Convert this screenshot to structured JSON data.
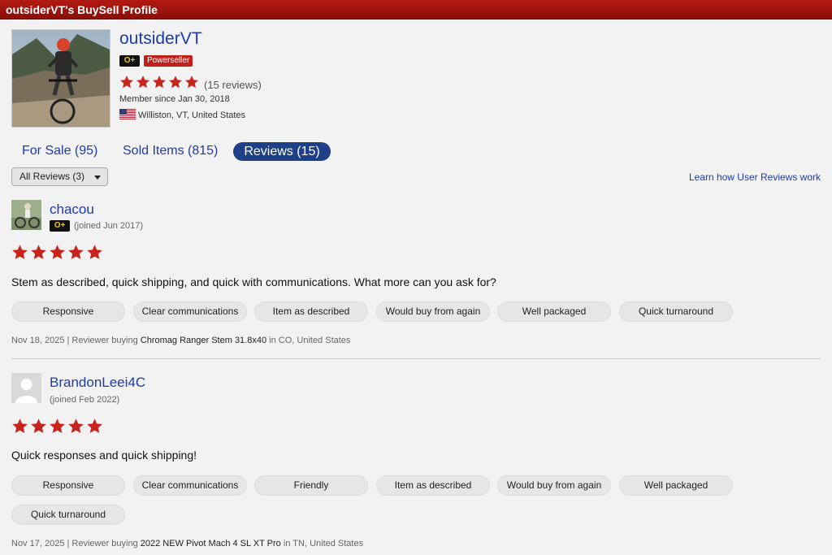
{
  "header": {
    "title": "outsiderVT's BuySell Profile"
  },
  "profile": {
    "username": "outsiderVT",
    "badge_op": "O+",
    "badge_power": "Powerseller",
    "rating_stars": 5,
    "reviews_count_text": "(15 reviews)",
    "member_since": "Member since Jan 30, 2018",
    "location": "Williston, VT, United States"
  },
  "tabs": [
    {
      "label": "For Sale (95)"
    },
    {
      "label": "Sold Items (815)"
    },
    {
      "label": "Reviews (15)"
    }
  ],
  "filter": {
    "selected": "All Reviews (3)"
  },
  "learn_link": "Learn how User Reviews work",
  "reviews": [
    {
      "name": "chacou",
      "badge": "O+",
      "joined": "(joined Jun 2017)",
      "stars": 5,
      "text": "Stem as described, quick shipping, and quick with communications. What more can you ask for?",
      "tags": [
        "Responsive",
        "Clear communications",
        "Item as described",
        "Would buy from again",
        "Well packaged",
        "Quick turnaround"
      ],
      "date_prefix": "Nov 18, 2025 | Reviewer buying ",
      "item": "Chromag Ranger Stem 31.8x40",
      "location_suffix": " in CO, United States"
    },
    {
      "name": "BrandonLeei4C",
      "joined": "(joined Feb 2022)",
      "stars": 5,
      "text": "Quick responses and quick shipping!",
      "tags": [
        "Responsive",
        "Clear communications",
        "Friendly",
        "Item as described",
        "Would buy from again",
        "Well packaged",
        "Quick turnaround"
      ],
      "date_prefix": "Nov 17, 2025 | Reviewer buying ",
      "item": "2022 NEW Pivot Mach 4 SL XT Pro",
      "location_suffix": " in TN, United States"
    }
  ],
  "colors": {
    "accent": "#1e3ca8",
    "header_red": "#a3150e",
    "star_red": "#c8231c"
  }
}
